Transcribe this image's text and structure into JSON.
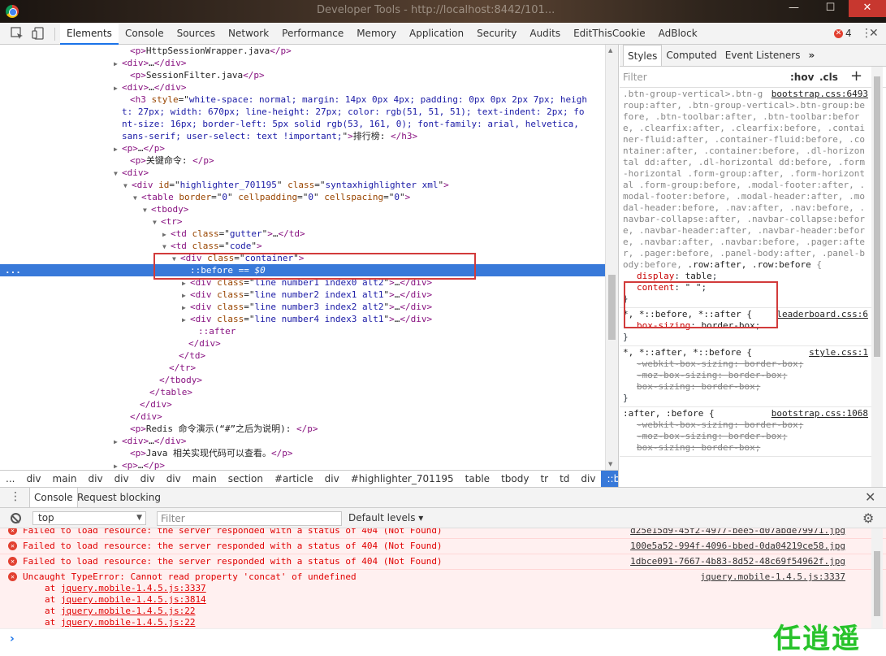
{
  "window": {
    "title": "Developer Tools - http://localhost:8442/101..."
  },
  "toolbar": {
    "tabs": [
      "Elements",
      "Console",
      "Sources",
      "Network",
      "Performance",
      "Memory",
      "Application",
      "Security",
      "Audits",
      "EditThisCookie",
      "AdBlock"
    ],
    "active_tab": "Elements",
    "error_count": "4"
  },
  "dom": {
    "lines": [
      {
        "indent": 150,
        "tri": "",
        "html": "<span class='tg'>&lt;p&gt;</span>HttpSessionWrapper.java<span class='tg'>&lt;/p&gt;</span>"
      },
      {
        "indent": 140,
        "tri": "▶",
        "html": "<span class='tg'>&lt;div&gt;</span>…<span class='tg'>&lt;/div&gt;</span>"
      },
      {
        "indent": 150,
        "tri": "",
        "html": "<span class='tg'>&lt;p&gt;</span>SessionFilter.java<span class='tg'>&lt;/p&gt;</span>"
      },
      {
        "indent": 140,
        "tri": "▶",
        "html": "<span class='tg'>&lt;div&gt;</span>…<span class='tg'>&lt;/div&gt;</span>"
      },
      {
        "indent": 150,
        "tri": "",
        "wrap": true,
        "html": "<span class='tg'>&lt;h3</span> <span class='an'>style</span>=\"<span class='av'>white-space: normal; margin: 14px 0px 4px; padding: 0px 0px 2px 7px; height: 27px; width: 670px; line-height: 27px; color: rgb(51, 51, 51); text-indent: 2px; font-size: 16px; border-left: 5px solid rgb(53, 161, 0); font-family: arial, helvetica, sans-serif; user-select: text !important;</span>\"<span class='tg'>&gt;</span>排行榜: <span class='tg'>&lt;/h3&gt;</span>"
      },
      {
        "indent": 140,
        "tri": "▶",
        "html": "<span class='tg'>&lt;p&gt;</span>…<span class='tg'>&lt;/p&gt;</span>"
      },
      {
        "indent": 150,
        "tri": "",
        "html": "<span class='tg'>&lt;p&gt;</span>关键命令: <span class='tg'>&lt;/p&gt;</span>"
      },
      {
        "indent": 140,
        "tri": "▼",
        "html": "<span class='tg'>&lt;div&gt;</span>"
      },
      {
        "indent": 152,
        "tri": "▼",
        "html": "<span class='tg'>&lt;div</span> <span class='an'>id</span>=\"<span class='av'>highlighter_701195</span>\" <span class='an'>class</span>=\"<span class='av'>syntaxhighlighter  xml</span>\"<span class='tg'>&gt;</span>"
      },
      {
        "indent": 164,
        "tri": "▼",
        "html": "<span class='tg'>&lt;table</span> <span class='an'>border</span>=\"<span class='av'>0</span>\" <span class='an'>cellpadding</span>=\"<span class='av'>0</span>\" <span class='an'>cellspacing</span>=\"<span class='av'>0</span>\"<span class='tg'>&gt;</span>"
      },
      {
        "indent": 176,
        "tri": "▼",
        "html": "<span class='tg'>&lt;tbody&gt;</span>"
      },
      {
        "indent": 188,
        "tri": "▼",
        "html": "<span class='tg'>&lt;tr&gt;</span>"
      },
      {
        "indent": 200,
        "tri": "▶",
        "html": "<span class='tg'>&lt;td</span> <span class='an'>class</span>=\"<span class='av'>gutter</span>\"<span class='tg'>&gt;</span>…<span class='tg'>&lt;/td&gt;</span>"
      },
      {
        "indent": 200,
        "tri": "▼",
        "html": "<span class='tg'>&lt;td</span> <span class='an'>class</span>=\"<span class='av'>code</span>\"<span class='tg'>&gt;</span>"
      },
      {
        "indent": 212,
        "tri": "▼",
        "html": "<span class='tg'>&lt;div</span> <span class='an'>class</span>=\"<span class='av'>container</span>\"<span class='tg'>&gt;</span>"
      },
      {
        "indent": 224,
        "tri": "",
        "sel": true,
        "html": "<span class='tg'>::before</span> == <i>$0</i>"
      },
      {
        "indent": 224,
        "tri": "▶",
        "html": "<span class='tg'>&lt;div</span> <span class='an'>class</span>=\"<span class='av'>line number1 index0 alt2</span>\"<span class='tg'>&gt;</span>…<span class='tg'>&lt;/div&gt;</span>"
      },
      {
        "indent": 224,
        "tri": "▶",
        "html": "<span class='tg'>&lt;div</span> <span class='an'>class</span>=\"<span class='av'>line number2 index1 alt1</span>\"<span class='tg'>&gt;</span>…<span class='tg'>&lt;/div&gt;</span>"
      },
      {
        "indent": 224,
        "tri": "▶",
        "html": "<span class='tg'>&lt;div</span> <span class='an'>class</span>=\"<span class='av'>line number3 index2 alt2</span>\"<span class='tg'>&gt;</span>…<span class='tg'>&lt;/div&gt;</span>"
      },
      {
        "indent": 224,
        "tri": "▶",
        "html": "<span class='tg'>&lt;div</span> <span class='an'>class</span>=\"<span class='av'>line number4 index3 alt1</span>\"<span class='tg'>&gt;</span>…<span class='tg'>&lt;/div&gt;</span>"
      },
      {
        "indent": 234,
        "tri": "",
        "html": "<span class='tg'>::after</span>"
      },
      {
        "indent": 222,
        "tri": "",
        "html": "<span class='tg'>&lt;/div&gt;</span>"
      },
      {
        "indent": 210,
        "tri": "",
        "html": "<span class='tg'>&lt;/td&gt;</span>"
      },
      {
        "indent": 198,
        "tri": "",
        "html": "<span class='tg'>&lt;/tr&gt;</span>"
      },
      {
        "indent": 186,
        "tri": "",
        "html": "<span class='tg'>&lt;/tbody&gt;</span>"
      },
      {
        "indent": 174,
        "tri": "",
        "html": "<span class='tg'>&lt;/table&gt;</span>"
      },
      {
        "indent": 162,
        "tri": "",
        "html": "<span class='tg'>&lt;/div&gt;</span>"
      },
      {
        "indent": 150,
        "tri": "",
        "html": "<span class='tg'>&lt;/div&gt;</span>"
      },
      {
        "indent": 150,
        "tri": "",
        "html": "<span class='tg'>&lt;p&gt;</span>Redis 命令演示(“#”之后为说明): <span class='tg'>&lt;/p&gt;</span>"
      },
      {
        "indent": 140,
        "tri": "▶",
        "html": "<span class='tg'>&lt;div&gt;</span>…<span class='tg'>&lt;/div&gt;</span>"
      },
      {
        "indent": 150,
        "tri": "",
        "html": "<span class='tg'>&lt;p&gt;</span>Java 相关实现代码可以查看。<span class='tg'>&lt;/p&gt;</span>"
      },
      {
        "indent": 140,
        "tri": "▶",
        "html": "<span class='tg'>&lt;p&gt;</span>…<span class='tg'>&lt;/p&gt;</span>"
      }
    ],
    "selected_dots": "..."
  },
  "breadcrumbs": [
    "...",
    "div",
    "main",
    "div",
    "div",
    "div",
    "div",
    "main",
    "section",
    "#article",
    "div",
    "#highlighter_701195",
    "table",
    "tbody",
    "tr",
    "td",
    "div",
    "::before"
  ],
  "styles": {
    "tabs": [
      "Styles",
      "Computed",
      "Event Listeners"
    ],
    "more": "»",
    "filter_placeholder": "Filter",
    "hov": ":hov",
    "cls": ".cls",
    "add": "+",
    "rule1": {
      "source": "bootstrap.css:6493",
      "selector_html": ".btn-group-vertical>.btn-group:after, .btn-group-vertical>.btn-group:before, .btn-toolbar:after, .btn-toolbar:before, .clearfix:after, .clearfix:before, .container-fluid:after, .container-fluid:before, .container:after, .container:before, .dl-horizontal dd:after, .dl-horizontal dd:before, .form-horizontal .form-group:after, .form-horizontal .form-group:before, .modal-footer:after, .modal-footer:before, .modal-header:after, .modal-header:before, .nav:after, .nav:before, .navbar-collapse:after, .navbar-collapse:before, .navbar-header:after, .navbar-header:before, .navbar:after, .navbar:before, .pager:after, .pager:before, .panel-body:after, .panel-body:before, <span class='m'>.row:after, .row:before</span> {",
      "decls": [
        {
          "p": "display",
          "v": "table"
        },
        {
          "p": "content",
          "v": "\" \""
        }
      ],
      "close": "}"
    },
    "rule2": {
      "source": "leaderboard.css:6",
      "selector": "*, *::before, *::after {",
      "decls": [
        {
          "p": "box-sizing",
          "v": "border-box"
        }
      ],
      "close": "}"
    },
    "rule3": {
      "source": "style.css:1",
      "selector": "*, *::after, *::before {",
      "decls": [
        {
          "p": "-webkit-box-sizing",
          "v": "border-box"
        },
        {
          "p": "-moz-box-sizing",
          "v": "border-box"
        },
        {
          "p": "box-sizing",
          "v": "border-box"
        }
      ],
      "close": "}"
    },
    "rule4": {
      "source": "bootstrap.css:1068",
      "selector": ":after, :before {",
      "decls": [
        {
          "p": "-webkit-box-sizing",
          "v": "border-box"
        },
        {
          "p": "-moz-box-sizing",
          "v": "border-box"
        },
        {
          "p": "box-sizing",
          "v": "border-box"
        }
      ]
    }
  },
  "drawer": {
    "tabs": [
      "Console",
      "Request blocking"
    ],
    "context": "top",
    "filter_placeholder": "Filter",
    "levels": "Default levels"
  },
  "console": {
    "messages": [
      {
        "text": "Failed to load resource: the server responded with a status of 404 (Not Found)",
        "link": "d25e15d9-45f2-4977-bee5-d07abde79971.jpg"
      },
      {
        "text": "Failed to load resource: the server responded with a status of 404 (Not Found)",
        "link": "100e5a52-994f-4096-bbed-0da04219ce58.jpg"
      },
      {
        "text": "Failed to load resource: the server responded with a status of 404 (Not Found)",
        "link": "1dbce091-7667-4b83-8d52-48c69f54962f.jpg"
      },
      {
        "text": "Uncaught TypeError: Cannot read property 'concat' of undefined",
        "link": "jquery.mobile-1.4.5.js:3337",
        "stack": [
          "jquery.mobile-1.4.5.js:3337",
          "jquery.mobile-1.4.5.js:3814",
          "jquery.mobile-1.4.5.js:22",
          "jquery.mobile-1.4.5.js:22"
        ]
      }
    ],
    "stack_prefix": "at"
  },
  "watermark": "任逍遥"
}
